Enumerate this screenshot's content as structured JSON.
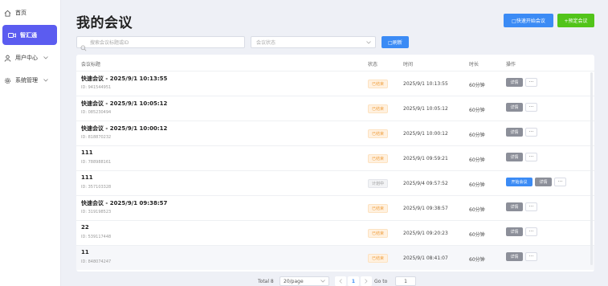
{
  "sidebar": {
    "items": [
      {
        "label": "首页",
        "icon": "home-icon"
      },
      {
        "label": "智汇通",
        "icon": "video-icon",
        "active": true
      },
      {
        "label": "用户中心",
        "icon": "user-icon"
      },
      {
        "label": "系统管理",
        "icon": "gear-icon"
      }
    ]
  },
  "header": {
    "title": "我的会议",
    "quick_start": "□快速开始会议",
    "book": "+预定会议"
  },
  "filters": {
    "search_placeholder": "搜索会议标题或ID",
    "status_placeholder": "会议状态",
    "refresh": "□刷新"
  },
  "table": {
    "headers": {
      "title": "会议标题",
      "status": "状态",
      "time": "时间",
      "duration": "时长",
      "ops": "操作"
    },
    "rows": [
      {
        "title": "快速会议 - 2025/9/1 10:13:55",
        "id": "ID: 941544951",
        "status": "已结束",
        "time": "2025/9/1 10:13:55",
        "duration": "60分钟"
      },
      {
        "title": "快速会议 - 2025/9/1 10:05:12",
        "id": "ID: 085230494",
        "status": "已结束",
        "time": "2025/9/1 10:05:12",
        "duration": "60分钟"
      },
      {
        "title": "快速会议 - 2025/9/1 10:00:12",
        "id": "ID: 818870232",
        "status": "已结束",
        "time": "2025/9/1 10:00:12",
        "duration": "60分钟"
      },
      {
        "title": "111",
        "id": "ID: 788988161",
        "status": "已结束",
        "time": "2025/9/1 09:59:21",
        "duration": "60分钟"
      },
      {
        "title": "111",
        "id": "ID: 357103328",
        "status": "计划中",
        "time": "2025/9/4 09:57:52",
        "duration": "60分钟",
        "can_start": true
      },
      {
        "title": "快速会议 - 2025/9/1 09:38:57",
        "id": "ID: 319198523",
        "status": "已结束",
        "time": "2025/9/1 09:38:57",
        "duration": "60分钟"
      },
      {
        "title": "22",
        "id": "ID: 539117448",
        "status": "已结束",
        "time": "2025/9/1 09:20:23",
        "duration": "60分钟"
      },
      {
        "title": "11",
        "id": "ID: 848074247",
        "status": "已结束",
        "time": "2025/9/1 08:41:07",
        "duration": "60分钟"
      }
    ],
    "op_start": "开始会议",
    "op_detail": "详情",
    "op_more": "···"
  },
  "pagination": {
    "total": "Total 8",
    "page_size": "20/page",
    "current_page": "1",
    "goto_label": "Go to",
    "goto_value": "1"
  },
  "colors": {
    "primary": "#3b8bf5",
    "success": "#52c41a",
    "sidebar_active": "#5b5cf0",
    "ended": "#f0a040"
  }
}
